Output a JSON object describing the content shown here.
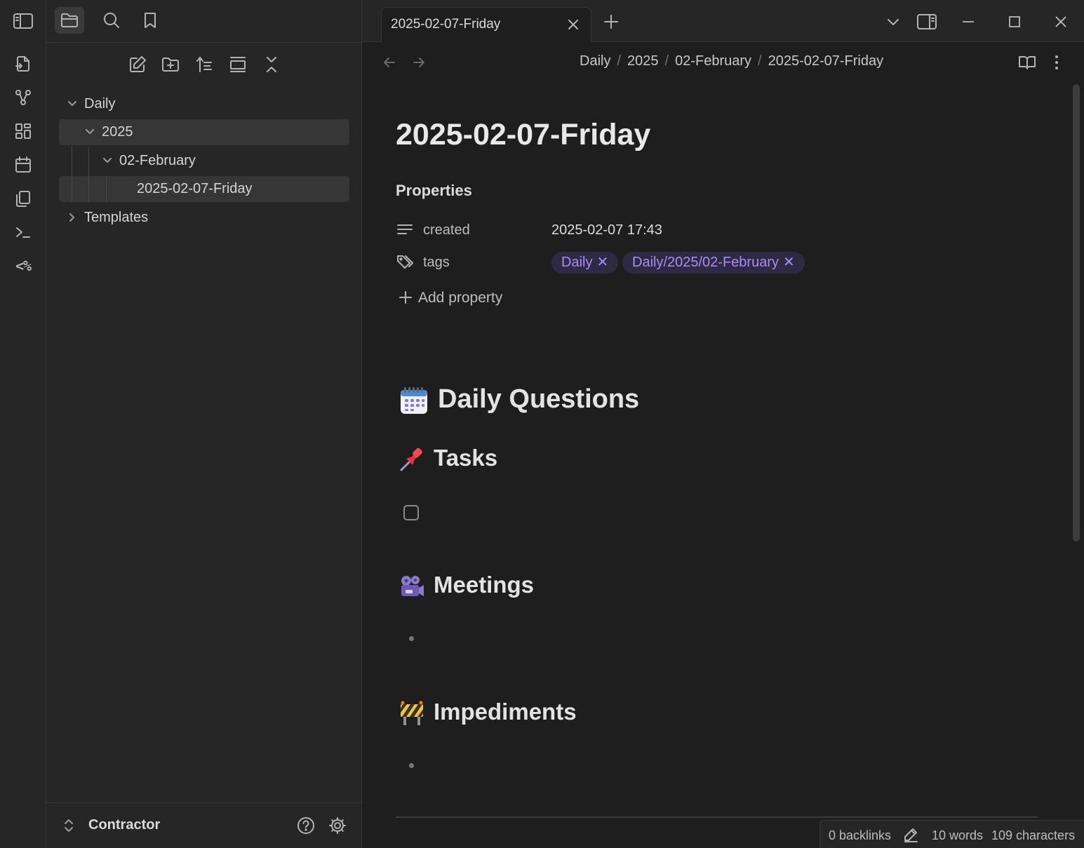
{
  "tab": {
    "title": "2025-02-07-Friday"
  },
  "breadcrumb": [
    "Daily",
    "2025",
    "02-February",
    "2025-02-07-Friday"
  ],
  "tree": [
    {
      "label": "Daily",
      "expanded": true
    },
    {
      "label": "2025",
      "expanded": true
    },
    {
      "label": "02-February",
      "expanded": true
    },
    {
      "label": "2025-02-07-Friday"
    },
    {
      "label": "Templates",
      "expanded": false
    }
  ],
  "vault": {
    "name": "Contractor"
  },
  "note": {
    "title": "2025-02-07-Friday",
    "properties_heading": "Properties",
    "properties": [
      {
        "key": "created",
        "icon": "text-lines-icon",
        "value": "2025-02-07 17:43"
      },
      {
        "key": "tags",
        "icon": "tags-icon",
        "values": [
          "Daily",
          "Daily/2025/02-February"
        ]
      }
    ],
    "add_property": "Add property",
    "tag_remove_glyph": "✕",
    "headings": [
      {
        "text": "Daily Questions",
        "icon": "calendar-emoji-icon"
      },
      {
        "text": "Tasks",
        "icon": "pushpin-emoji-icon"
      },
      {
        "text": "Meetings",
        "icon": "movie-camera-emoji-icon"
      },
      {
        "text": "Impediments",
        "icon": "construction-emoji-icon"
      }
    ]
  },
  "status": {
    "backlinks": "0 backlinks",
    "words": "10 words",
    "characters": "109 characters"
  },
  "ribbon": {
    "templater_label": "<%"
  },
  "colors": {
    "accent": "#a88bfa",
    "tag_bg": "#2e2a42",
    "background": "#1e1e1e",
    "panel": "#262626"
  }
}
